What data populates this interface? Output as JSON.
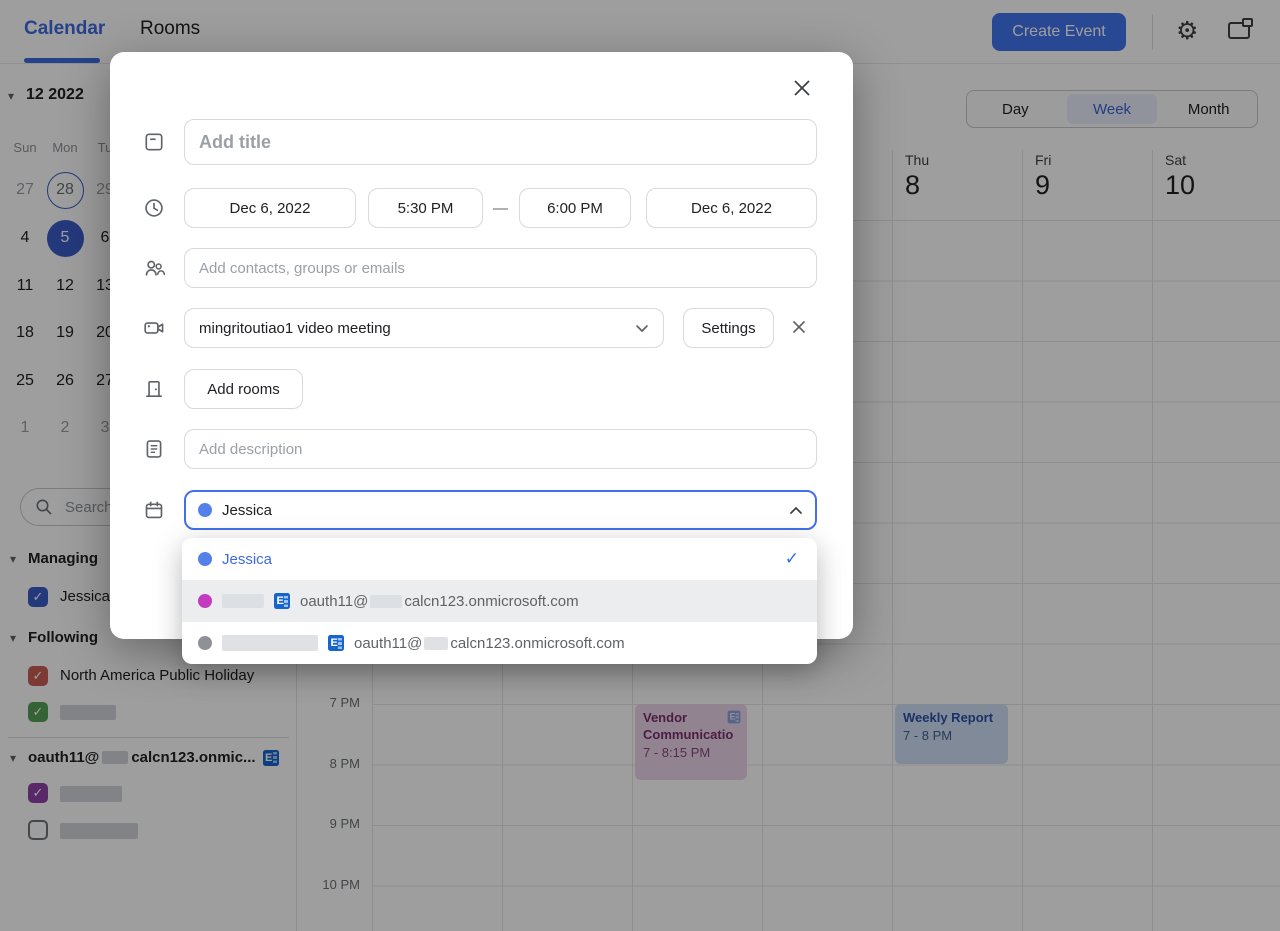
{
  "topbar": {
    "tabs": [
      {
        "label": "Calendar"
      },
      {
        "label": "Rooms"
      }
    ],
    "create_event": "Create Event"
  },
  "view": {
    "options": [
      "Day",
      "Week",
      "Month"
    ],
    "active": "Week"
  },
  "sidebar": {
    "mini_calendar": {
      "title": "12 2022",
      "weekdays": [
        "Sun",
        "Mon",
        "Tu"
      ],
      "rows": [
        [
          "27",
          "28",
          "29"
        ],
        [
          "4",
          "5",
          "6"
        ],
        [
          "11",
          "12",
          "13"
        ],
        [
          "18",
          "19",
          "20"
        ],
        [
          "25",
          "26",
          "27"
        ],
        [
          "1",
          "2",
          "3"
        ]
      ],
      "outlined_date": "28",
      "selected_date": "5"
    },
    "search_placeholder": "Search",
    "managing": {
      "header": "Managing",
      "item": "Jessica"
    },
    "following": {
      "header": "Following",
      "item1": "North America Public Holiday"
    },
    "exchange_section": {
      "prefix": "oauth11@",
      "suffix": "calcn123.onmic..."
    }
  },
  "week": {
    "day_headers": [
      {
        "name": "Thu",
        "num": "8"
      },
      {
        "name": "Fri",
        "num": "9"
      },
      {
        "name": "Sat",
        "num": "10"
      }
    ],
    "time_labels": [
      "7 PM",
      "8 PM",
      "9 PM",
      "10 PM"
    ],
    "events": [
      {
        "title_line1": "Vendor",
        "title_line2": "Communicatio",
        "time": "7 - 8:15 PM"
      },
      {
        "title": "Weekly Report",
        "time": "7 - 8 PM"
      }
    ]
  },
  "modal": {
    "title_placeholder": "Add title",
    "start_date": "Dec 6, 2022",
    "start_time": "5:30 PM",
    "time_separator": "—",
    "end_time": "6:00 PM",
    "end_date": "Dec 6, 2022",
    "contacts_placeholder": "Add contacts, groups or emails",
    "video_value": "mingritoutiao1 video meeting",
    "settings_label": "Settings",
    "rooms_label": "Add rooms",
    "description_placeholder": "Add description",
    "calendar_value": "Jessica",
    "dropdown": [
      {
        "label": "Jessica",
        "selected": true
      },
      {
        "email_prefix": "oauth11@",
        "email_suffix": "calcn123.onmicrosoft.com"
      },
      {
        "email_prefix": "oauth11@",
        "email_suffix": "calcn123.onmicrosoft.com"
      }
    ]
  },
  "colors": {
    "accent_blue": "#3D6BE0",
    "create_event_bg": "#4374EF",
    "selected_day_bg": "#3A5CC9",
    "checkbox_blue": "#3A5CC9",
    "checkbox_red": "#C75F55",
    "checkbox_green": "#56A156",
    "checkbox_purple": "#9042A8",
    "dot_blue": "#5480EA",
    "dot_magenta": "#C43BC0",
    "dot_gray": "#8E9196",
    "event_pink_bg": "#EBD6E8",
    "event_blue_bg": "#CFDFF6",
    "week_active_bg": "#E8EDFA"
  }
}
